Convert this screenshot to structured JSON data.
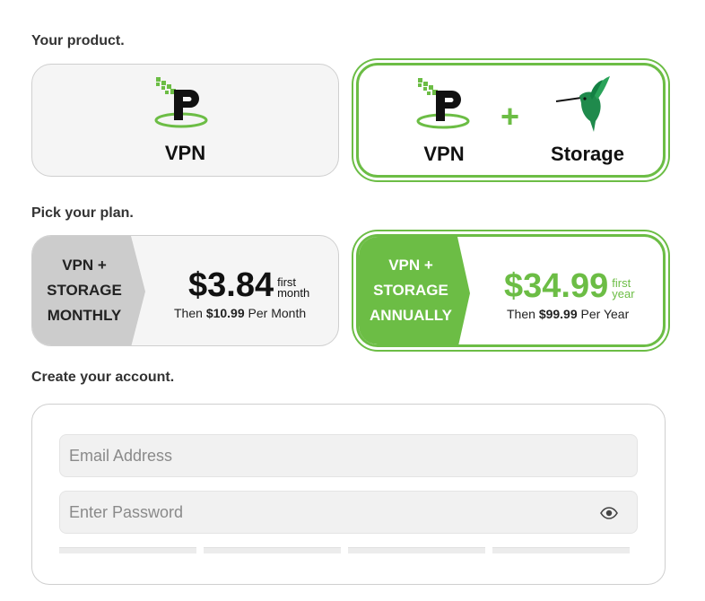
{
  "sections": {
    "product_title": "Your product.",
    "plan_title": "Pick your plan.",
    "account_title": "Create your account."
  },
  "products": [
    {
      "label": "VPN",
      "icons": [
        "ipvanish-logo-icon"
      ],
      "selected": false
    },
    {
      "label": "VPN",
      "label2": "Storage",
      "plus": "+",
      "icons": [
        "ipvanish-logo-icon",
        "hummingbird-icon"
      ],
      "selected": true
    }
  ],
  "plans": [
    {
      "name_lines": [
        "VPN +",
        "STORAGE",
        "MONTHLY"
      ],
      "price": "$3.84",
      "suffix1": "first",
      "suffix2": "month",
      "then_prefix": "Then",
      "then_price": "$10.99",
      "then_suffix": "Per Month",
      "selected": false
    },
    {
      "name_lines": [
        "VPN +",
        "STORAGE",
        "ANNUALLY"
      ],
      "price": "$34.99",
      "suffix1": "first",
      "suffix2": "year",
      "then_prefix": "Then",
      "then_price": "$99.99",
      "then_suffix": "Per Year",
      "selected": true
    }
  ],
  "account": {
    "email_placeholder": "Email Address",
    "password_placeholder": "Enter Password",
    "password_toggle_icon": "eye-icon"
  },
  "colors": {
    "accent": "#6cbd45",
    "unselected_tab": "#cccccc",
    "card_bg": "#f5f5f5"
  }
}
